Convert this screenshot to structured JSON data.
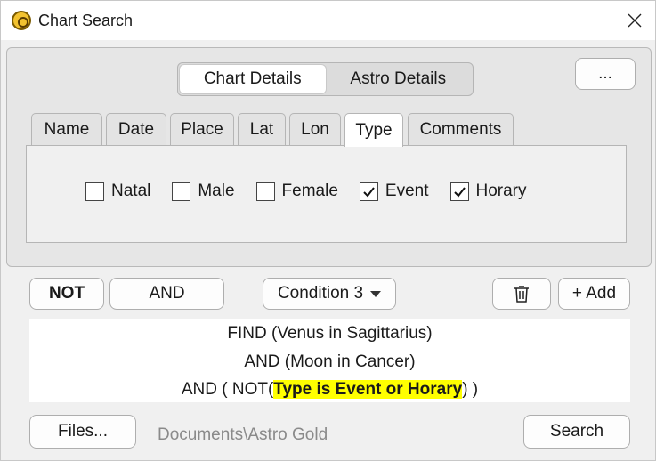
{
  "window": {
    "title": "Chart Search"
  },
  "segments": [
    "Chart Details",
    "Astro Details"
  ],
  "more_label": "...",
  "tabs": [
    "Name",
    "Date",
    "Place",
    "Lat",
    "Lon",
    "Type",
    "Comments"
  ],
  "active_tab": "Type",
  "types": [
    {
      "label": "Natal",
      "checked": false
    },
    {
      "label": "Male",
      "checked": false
    },
    {
      "label": "Female",
      "checked": false
    },
    {
      "label": "Event",
      "checked": true
    },
    {
      "label": "Horary",
      "checked": true
    }
  ],
  "toolbar": {
    "not_label": "NOT",
    "and_label": "AND",
    "condition_label": "Condition 3",
    "add_label": "+ Add"
  },
  "query": {
    "line1": "FIND (Venus in Sagittarius)",
    "line2": "AND (Moon in Cancer)",
    "line3_prefix": "AND ( NOT(",
    "line3_highlight": "Type is Event or Horary",
    "line3_suffix": ") )",
    "highlight_color": "#ffff00"
  },
  "footer": {
    "files_label": "Files...",
    "path": "Documents\\Astro Gold",
    "search_label": "Search"
  }
}
